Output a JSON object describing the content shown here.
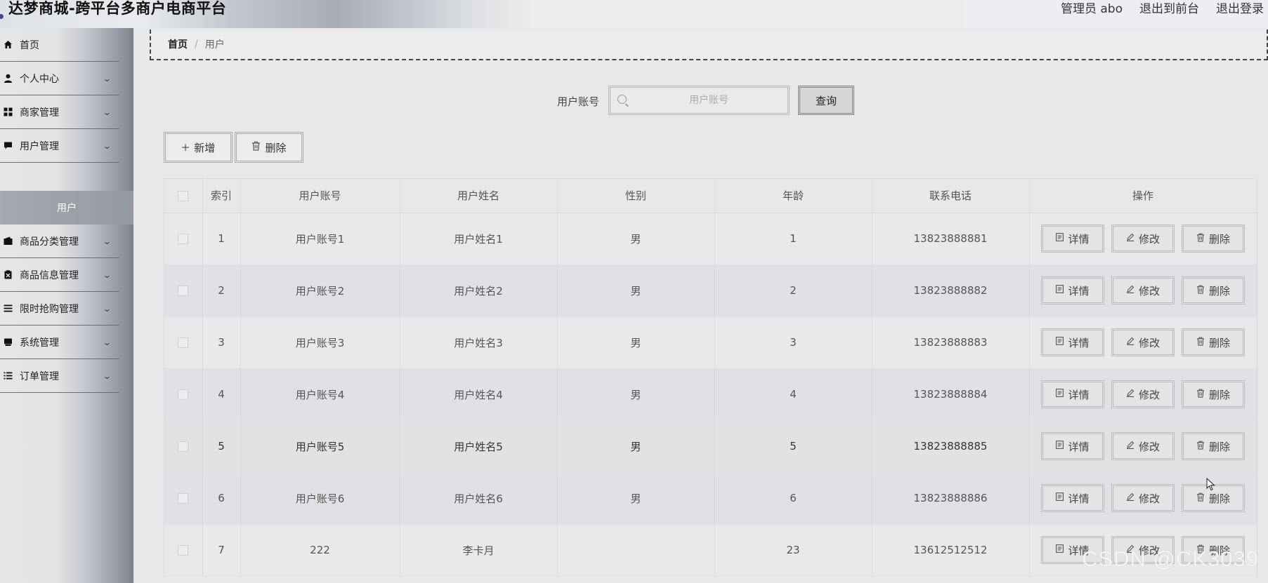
{
  "header": {
    "title": "达梦商城-跨平台多商户电商平台",
    "user_label": "管理员 abo",
    "frontend_link": "退出到前台",
    "logout_link": "退出登录"
  },
  "sidebar": {
    "items": [
      {
        "label": "首页",
        "icon": "home-icon"
      },
      {
        "label": "个人中心",
        "icon": "user-icon"
      },
      {
        "label": "商家管理",
        "icon": "grid-icon"
      },
      {
        "label": "用户管理",
        "icon": "chat-icon"
      },
      {
        "label": "商品分类管理",
        "icon": "wallet-icon"
      },
      {
        "label": "商品信息管理",
        "icon": "clipboard-icon"
      },
      {
        "label": "限时抢购管理",
        "icon": "list-icon"
      },
      {
        "label": "系统管理",
        "icon": "box-icon"
      },
      {
        "label": "订单管理",
        "icon": "list-icon"
      }
    ],
    "active_sub": "用户"
  },
  "breadcrumb": {
    "home": "首页",
    "separator": "/",
    "current": "用户"
  },
  "search": {
    "label": "用户账号",
    "placeholder": "用户账号",
    "button": "查询"
  },
  "actions": {
    "add": "新增",
    "delete": "删除"
  },
  "table": {
    "headers": [
      "索引",
      "用户账号",
      "用户姓名",
      "性别",
      "年龄",
      "联系电话",
      "操作"
    ],
    "op_labels": {
      "detail": "详情",
      "edit": "修改",
      "delete": "删除"
    },
    "rows": [
      {
        "index": "1",
        "account": "用户账号1",
        "name": "用户姓名1",
        "gender": "男",
        "age": "1",
        "phone": "13823888881"
      },
      {
        "index": "2",
        "account": "用户账号2",
        "name": "用户姓名2",
        "gender": "男",
        "age": "2",
        "phone": "13823888882"
      },
      {
        "index": "3",
        "account": "用户账号3",
        "name": "用户姓名3",
        "gender": "男",
        "age": "3",
        "phone": "13823888883"
      },
      {
        "index": "4",
        "account": "用户账号4",
        "name": "用户姓名4",
        "gender": "男",
        "age": "4",
        "phone": "13823888884"
      },
      {
        "index": "5",
        "account": "用户账号5",
        "name": "用户姓名5",
        "gender": "男",
        "age": "5",
        "phone": "13823888885"
      },
      {
        "index": "6",
        "account": "用户账号6",
        "name": "用户姓名6",
        "gender": "男",
        "age": "6",
        "phone": "13823888886"
      },
      {
        "index": "7",
        "account": "222",
        "name": "李卡月",
        "gender": "",
        "age": "23",
        "phone": "13612512512"
      }
    ]
  },
  "watermark": "CSDN @CK3039"
}
